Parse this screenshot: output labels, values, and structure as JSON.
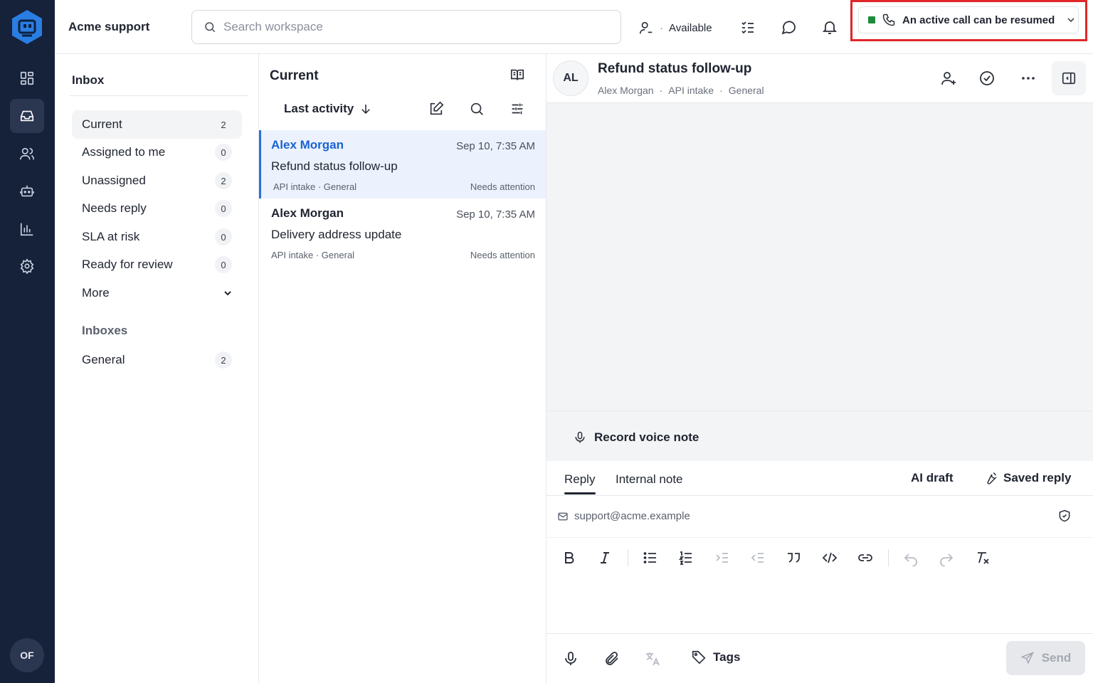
{
  "app": {
    "workspace_name": "Acme support",
    "user_initials": "OF",
    "rail_items": [
      "dashboard-icon",
      "inbox-icon",
      "contacts-icon",
      "bot-icon",
      "reports-icon",
      "settings-icon"
    ]
  },
  "topbar": {
    "search_placeholder": "Search workspace",
    "availability": "Available",
    "call_banner": "An active call can be resumed",
    "call_status_color": "#1e8a3c",
    "highlight_color": "#e0262a"
  },
  "inbox": {
    "title": "Inbox",
    "folders": [
      {
        "label": "Current",
        "count": "2"
      },
      {
        "label": "Assigned to me",
        "count": "0"
      },
      {
        "label": "Unassigned",
        "count": "2"
      },
      {
        "label": "Needs reply",
        "count": "0"
      },
      {
        "label": "SLA at risk",
        "count": "0"
      },
      {
        "label": "Ready for review",
        "count": "0"
      }
    ],
    "more_label": "More",
    "inboxes_section": "Inboxes",
    "inboxes": [
      {
        "label": "General",
        "count": "2"
      }
    ]
  },
  "list": {
    "title": "Current",
    "sort_label": "Last activity",
    "conversations": [
      {
        "name": "Alex Morgan",
        "time": "Sep 10, 7:35 AM",
        "subject": "Refund status follow-up",
        "meta": "API intake · General",
        "status": "Needs attention"
      },
      {
        "name": "Alex Morgan",
        "time": "Sep 10, 7:35 AM",
        "subject": "Delivery address update",
        "meta": "API intake · General",
        "status": "Needs attention"
      }
    ]
  },
  "conversation": {
    "initials": "AL",
    "title": "Refund status follow-up",
    "contact": "Alex Morgan",
    "source": "API intake",
    "inbox": "General",
    "separator": "·"
  },
  "composer": {
    "voice_note": "Record voice note",
    "tab_reply": "Reply",
    "tab_note": "Internal note",
    "ai_draft": "AI draft",
    "saved_reply": "Saved reply",
    "from_email": "support@acme.example",
    "tags_label": "Tags",
    "send_label": "Send",
    "accent_color": "#1a62d1"
  }
}
